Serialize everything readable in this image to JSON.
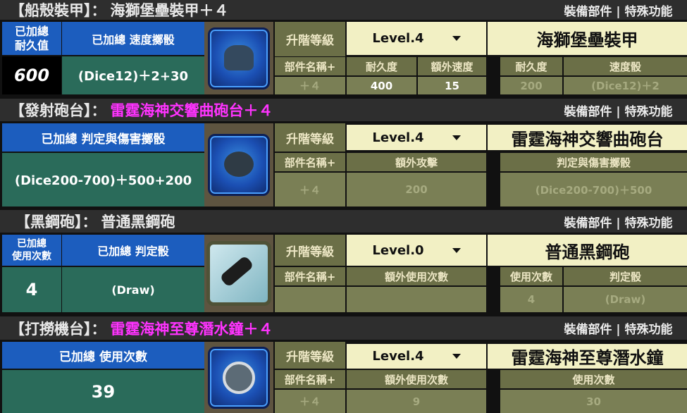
{
  "header_right": "裝備部件 | 特殊功能",
  "upgrade_label": "升階等級",
  "sections": [
    {
      "category": "【船殼裝甲】：",
      "item_name": "海獅堡壘裝甲＋４",
      "title_color": "#e8e8e8",
      "totals": [
        {
          "label": "已加總\n耐久值",
          "value": "600"
        },
        {
          "label": "已加總  速度擲骰",
          "value": "(Dice12)＋2+30"
        }
      ],
      "level": "Level.4",
      "part_name": "海獅堡壘裝甲",
      "stats_left": {
        "headers": [
          "部件名稱+",
          "耐久度",
          "額外速度"
        ],
        "values": [
          "＋４",
          "400",
          "15"
        ]
      },
      "stats_right": {
        "headers": [
          "耐久度",
          "速度骰"
        ],
        "values": [
          "200",
          "(Dice12)＋2"
        ]
      },
      "icon": "armor-icon"
    },
    {
      "category": "【發射砲台】：",
      "item_name": "雷霆海神交響曲砲台＋４",
      "title_color": "#ff33ff",
      "totals": [
        {
          "label": "已加總  判定與傷害擲骰",
          "value": "(Dice200-700)＋500+200"
        }
      ],
      "level": "Level.4",
      "part_name": "雷霆海神交響曲砲台",
      "stats_left": {
        "headers": [
          "部件名稱+",
          "額外攻擊"
        ],
        "values": [
          "＋４",
          "200"
        ]
      },
      "stats_right": {
        "headers": [
          "判定與傷害擲骰"
        ],
        "values": [
          "(Dice200-700)＋500"
        ]
      },
      "icon": "cannon-icon"
    },
    {
      "category": "【黑鋼砲】：",
      "item_name": "普通黑鋼砲",
      "title_color": "#e8e8e8",
      "totals": [
        {
          "label": "已加總\n使用次數",
          "value": "4"
        },
        {
          "label": "已加總   判定骰",
          "value": "(Draw)"
        }
      ],
      "level": "Level.0",
      "part_name": "普通黑鋼砲",
      "stats_left": {
        "headers": [
          "部件名稱+",
          "額外使用次數"
        ],
        "values": [
          "",
          ""
        ]
      },
      "stats_right": {
        "headers": [
          "使用次數",
          "判定骰"
        ],
        "values": [
          "4",
          "(Draw)"
        ]
      },
      "icon": "black-cannon-icon"
    },
    {
      "category": "【打撈機台】：",
      "item_name": "雷霆海神至尊潛水鐘＋４",
      "title_color": "#ff33ff",
      "totals": [
        {
          "label": "已加總  使用次數",
          "value": "39"
        }
      ],
      "level": "Level.4",
      "part_name": "雷霆海神至尊潛水鐘",
      "stats_left": {
        "headers": [
          "部件名稱+",
          "額外使用次數"
        ],
        "values": [
          "＋４",
          "9"
        ]
      },
      "stats_right": {
        "headers": [
          "使用次數"
        ],
        "values": [
          "30"
        ]
      },
      "icon": "diving-bell-icon"
    }
  ]
}
